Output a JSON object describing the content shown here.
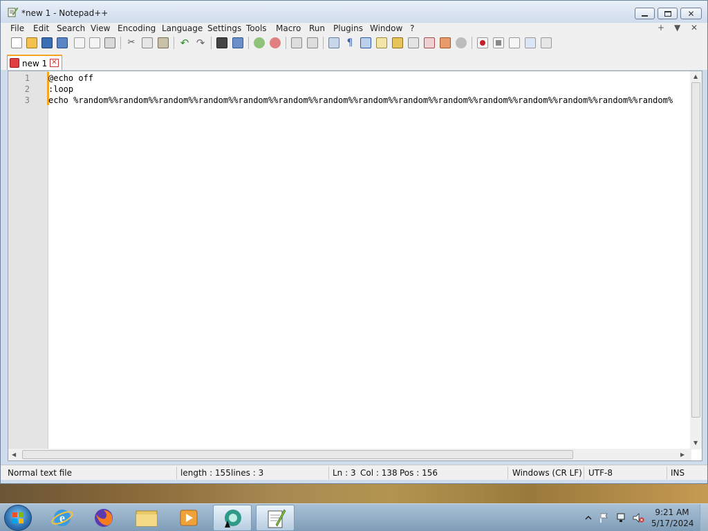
{
  "window": {
    "title": "*new 1 - Notepad++",
    "controls": {
      "minimize": "minimize",
      "maximize": "maximize",
      "close": "close"
    }
  },
  "menu": {
    "items": [
      "File",
      "Edit",
      "Search",
      "View",
      "Encoding",
      "Language",
      "Settings",
      "Tools",
      "Macro",
      "Run",
      "Plugins",
      "Window",
      "?"
    ],
    "right": [
      "+",
      "▼",
      "✕"
    ]
  },
  "toolbar": {
    "icons": [
      "new-file",
      "open-file",
      "save",
      "save-all",
      "close",
      "close-all",
      "print",
      "cut",
      "copy",
      "paste",
      "undo",
      "redo",
      "find",
      "replace",
      "zoom-in",
      "zoom-out",
      "sync-vertical",
      "sync-horizontal",
      "word-wrap",
      "show-all-characters",
      "indent-guide",
      "user-defined-language",
      "document-map",
      "document-list",
      "function-list",
      "folder-as-workspace",
      "monitoring",
      "record-macro",
      "stop-recording",
      "playback-macro",
      "run-macro-multiple",
      "save-macro"
    ]
  },
  "tabs": [
    {
      "label": "new 1",
      "close": "✕"
    }
  ],
  "editor": {
    "line_numbers": [
      "1",
      "2",
      "3"
    ],
    "lines": [
      "@echo off",
      ":loop",
      "echo %random%%random%%random%%random%%random%%random%%random%%random%%random%%random%%random%%random%%random%%random%%random%"
    ]
  },
  "statusbar": {
    "file_type": "Normal text file",
    "length": "length : 155",
    "lines": "lines : 3",
    "ln": "Ln : 3",
    "col": "Col : 138",
    "pos": "Pos : 156",
    "eol": "Windows (CR LF)",
    "encoding": "UTF-8",
    "mode": "INS"
  },
  "taskbar": {
    "apps": [
      "internet-explorer",
      "firefox",
      "file-explorer",
      "media-player",
      "active-app",
      "notepad-plus-plus"
    ],
    "tray_icons": [
      "show-hidden-icons",
      "action-center-flag",
      "network",
      "volume-muted"
    ],
    "time": "9:21 AM",
    "date": "5/17/2024"
  },
  "colors": {
    "accent_tab": "#f6a520",
    "title_bg": "#cfdcec",
    "gutter_bg": "#e4e4e4"
  }
}
